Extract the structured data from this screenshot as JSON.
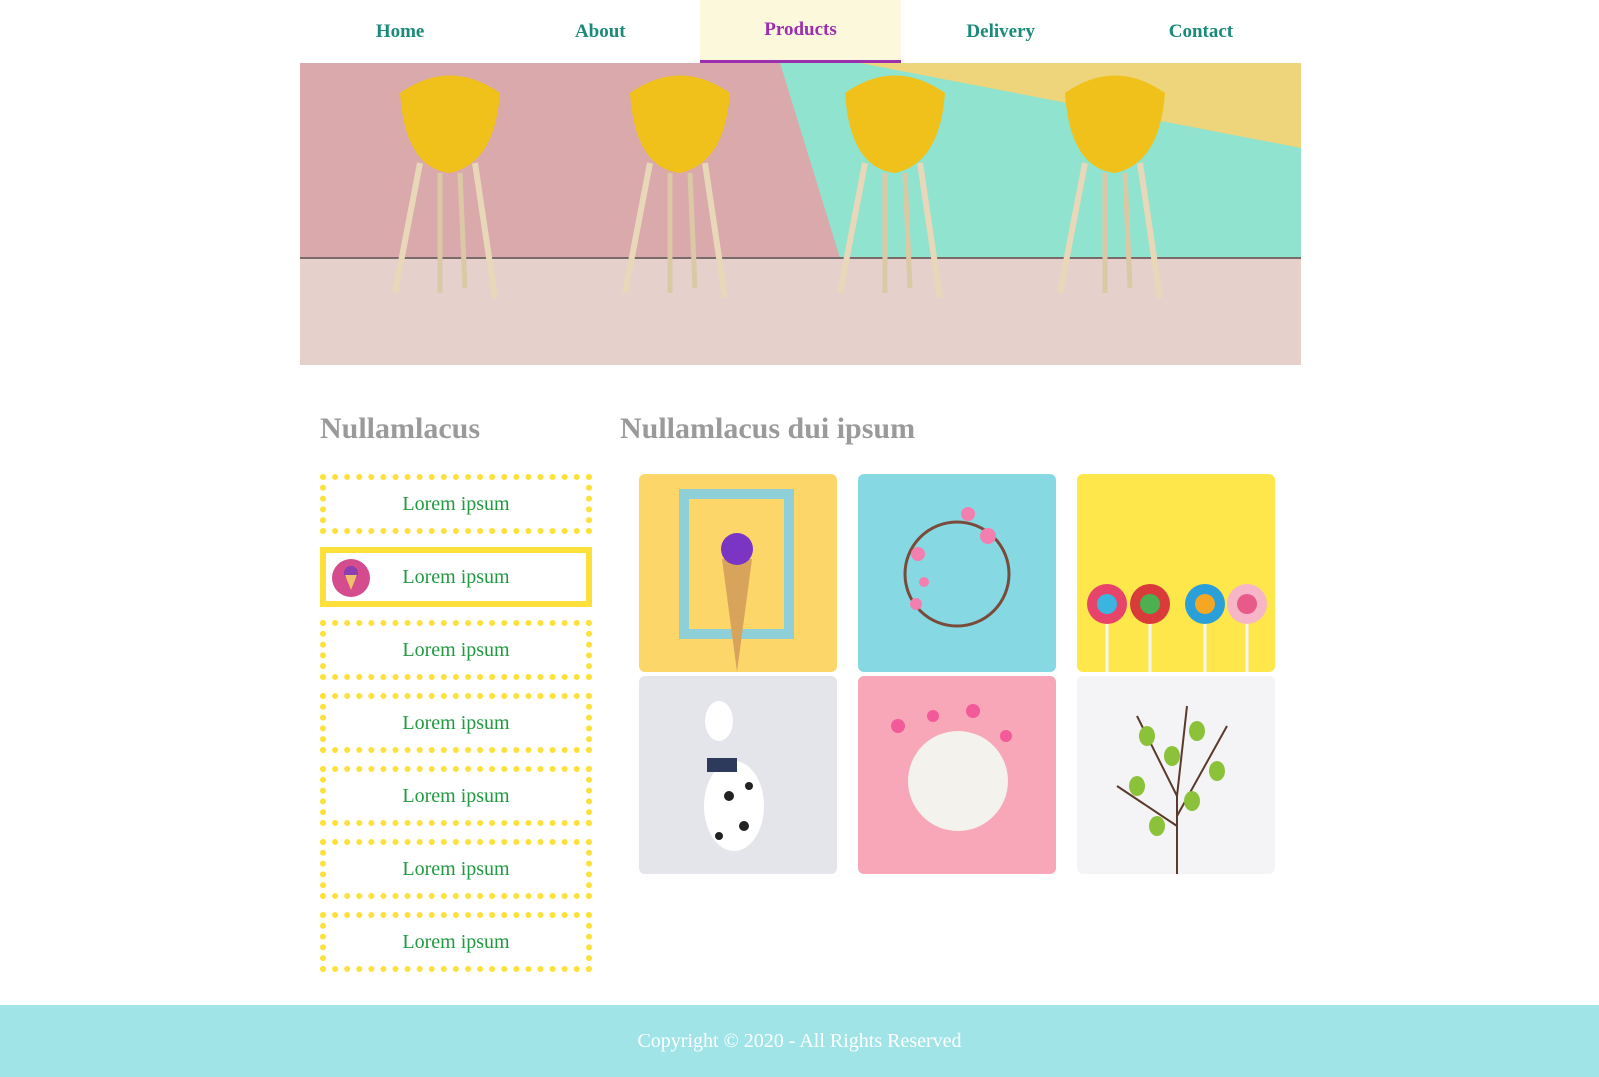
{
  "nav": {
    "items": [
      {
        "label": "Home"
      },
      {
        "label": "About"
      },
      {
        "label": "Products"
      },
      {
        "label": "Delivery"
      },
      {
        "label": "Contact"
      }
    ],
    "active": "Products"
  },
  "sidebar": {
    "title": "Nullamlacus",
    "items": [
      {
        "label": "Lorem ipsum"
      },
      {
        "label": "Lorem ipsum"
      },
      {
        "label": "Lorem ipsum"
      },
      {
        "label": "Lorem ipsum"
      },
      {
        "label": "Lorem ipsum"
      },
      {
        "label": "Lorem ipsum"
      },
      {
        "label": "Lorem ipsum"
      }
    ]
  },
  "gallery": {
    "title": "Nullamlacus dui ipsum"
  },
  "footer": {
    "text": "Copyright © 2020 - All Rights Reserved"
  },
  "colors": {
    "nav_text": "#1a8a7a",
    "nav_active_text": "#9b2fae",
    "nav_active_bg": "#fcf8dc",
    "heading": "#9a9a9a",
    "menu_border": "#fde03a",
    "menu_text": "#1f9a3f",
    "footer_bg": "#a0e4e8"
  }
}
